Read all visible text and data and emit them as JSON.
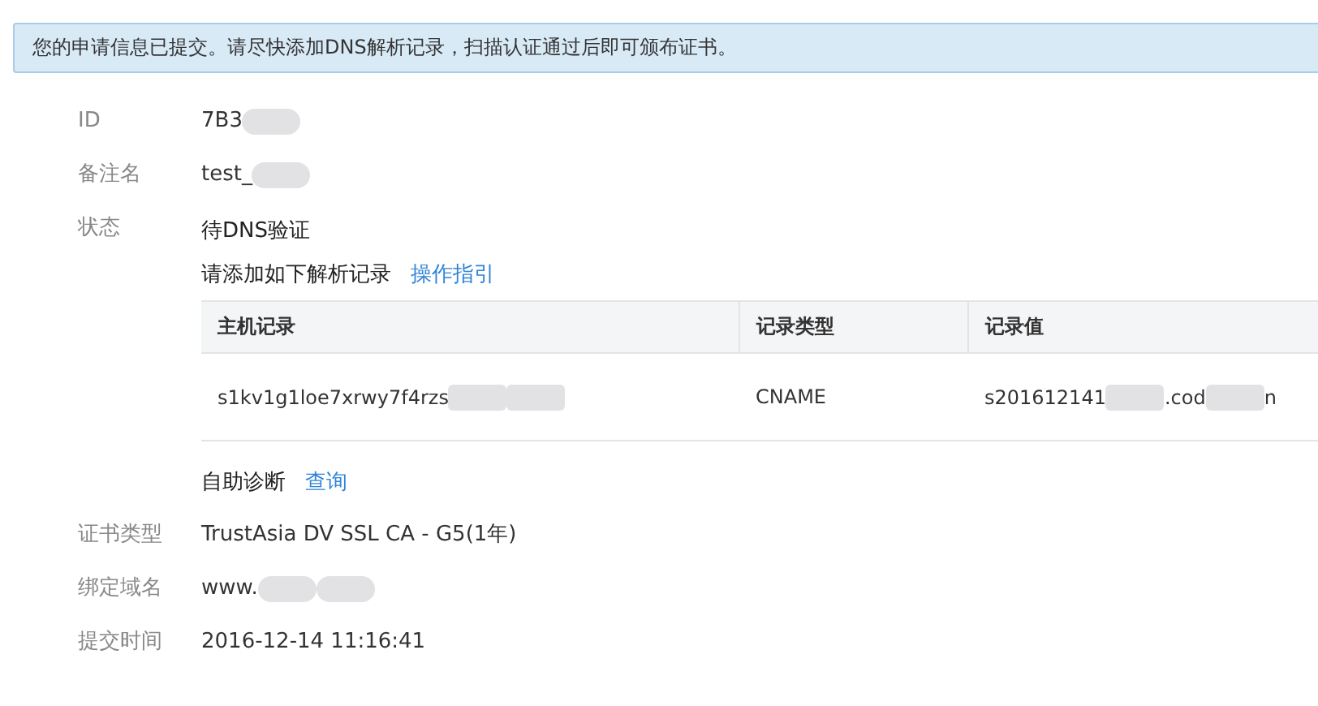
{
  "alert": {
    "text": "您的申请信息已提交。请尽快添加DNS解析记录，扫描认证通过后即可颁布证书。"
  },
  "fields_top": [
    {
      "label": "ID",
      "value": [
        {
          "kind": "text",
          "text": "7B3"
        },
        {
          "kind": "blur"
        }
      ]
    },
    {
      "label": "备注名",
      "value": [
        {
          "kind": "text",
          "text": "test_"
        },
        {
          "kind": "blur"
        }
      ]
    }
  ],
  "status": {
    "label": "状态",
    "value": "待DNS验证",
    "instruction": "请添加如下解析记录",
    "guide_link": "操作指引",
    "table": {
      "columns": [
        "主机记录",
        "记录类型",
        "记录值"
      ],
      "rows": [
        [
          [
            {
              "kind": "text",
              "text": "s1kv1g1loe7xrwy7f4rzs"
            },
            {
              "kind": "blur"
            },
            {
              "kind": "blur"
            }
          ],
          [
            {
              "kind": "text",
              "text": "CNAME"
            }
          ],
          [
            {
              "kind": "text",
              "text": "s201612141"
            },
            {
              "kind": "blur"
            },
            {
              "kind": "text",
              "text": ".cod"
            },
            {
              "kind": "blur"
            },
            {
              "kind": "text",
              "text": "n"
            }
          ]
        ]
      ]
    },
    "diagnose_label": "自助诊断",
    "diagnose_link": "查询"
  },
  "fields_bottom": [
    {
      "label": "证书类型",
      "value": [
        {
          "kind": "text",
          "text": "TrustAsia DV SSL CA - G5(1年)"
        }
      ]
    },
    {
      "label": "绑定域名",
      "value": [
        {
          "kind": "text",
          "text": "www."
        },
        {
          "kind": "blur"
        },
        {
          "kind": "blur"
        }
      ]
    },
    {
      "label": "提交时间",
      "value": [
        {
          "kind": "text",
          "text": "2016-12-14 11:16:41"
        }
      ]
    }
  ]
}
